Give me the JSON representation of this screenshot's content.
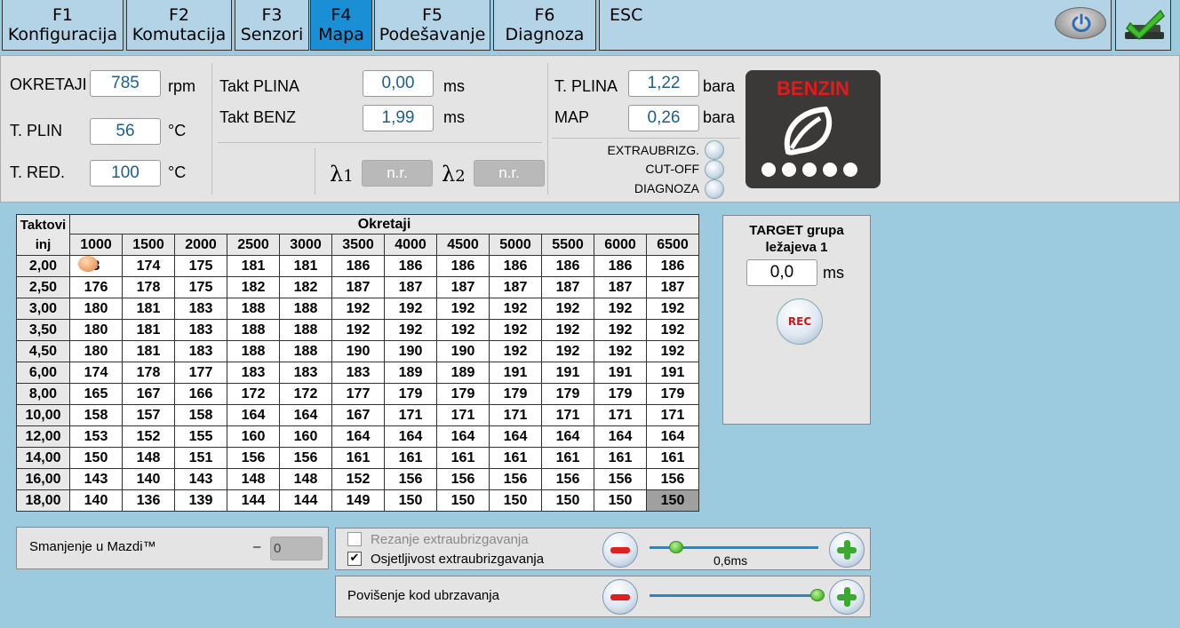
{
  "tabs": [
    {
      "key": "F1",
      "label": "Konfiguracija"
    },
    {
      "key": "F2",
      "label": "Komutacija"
    },
    {
      "key": "F3",
      "label": "Senzori"
    },
    {
      "key": "F4",
      "label": "Mapa"
    },
    {
      "key": "F5",
      "label": "Podešavanje"
    },
    {
      "key": "F6",
      "label": "Diagnoza"
    }
  ],
  "active_tab": "F4",
  "esc_label": "ESC",
  "sensors": {
    "okretaji": {
      "label": "OKRETAJI",
      "value": "785",
      "unit": "rpm"
    },
    "t_plin": {
      "label": "T. PLIN",
      "value": "56",
      "unit": "°C"
    },
    "t_red": {
      "label": "T. RED.",
      "value": "100",
      "unit": "°C"
    },
    "takt_plina": {
      "label": "Takt PLINA",
      "value": "0,00",
      "unit": "ms"
    },
    "takt_benz": {
      "label": "Takt BENZ",
      "value": "1,99",
      "unit": "ms"
    },
    "lambda1": {
      "symbol": "λ",
      "index": "1",
      "value": "n.r."
    },
    "lambda2": {
      "symbol": "λ",
      "index": "2",
      "value": "n.r."
    },
    "t_plina": {
      "label": "T. PLINA",
      "value": "1,22",
      "unit": "bara"
    },
    "map": {
      "label": "MAP",
      "value": "0,26",
      "unit": "bara"
    }
  },
  "indicators": [
    "EXTRAUBRIZG.",
    "CUT-OFF",
    "DIAGNOZA"
  ],
  "fuel_mode": "BENZIN",
  "map_table": {
    "corner_label": "Taktovi inj",
    "col_title": "Okretaji",
    "columns": [
      "1000",
      "1500",
      "2000",
      "2500",
      "3000",
      "3500",
      "4000",
      "4500",
      "5000",
      "5500",
      "6000",
      "6500"
    ],
    "rows": [
      {
        "label": "2,00",
        "values": [
          "3",
          "174",
          "175",
          "181",
          "181",
          "186",
          "186",
          "186",
          "186",
          "186",
          "186",
          "186"
        ]
      },
      {
        "label": "2,50",
        "values": [
          "176",
          "178",
          "175",
          "182",
          "182",
          "187",
          "187",
          "187",
          "187",
          "187",
          "187",
          "187"
        ]
      },
      {
        "label": "3,00",
        "values": [
          "180",
          "181",
          "183",
          "188",
          "188",
          "192",
          "192",
          "192",
          "192",
          "192",
          "192",
          "192"
        ]
      },
      {
        "label": "3,50",
        "values": [
          "180",
          "181",
          "183",
          "188",
          "188",
          "192",
          "192",
          "192",
          "192",
          "192",
          "192",
          "192"
        ]
      },
      {
        "label": "4,50",
        "values": [
          "180",
          "181",
          "183",
          "188",
          "188",
          "190",
          "190",
          "190",
          "192",
          "192",
          "192",
          "192"
        ]
      },
      {
        "label": "6,00",
        "values": [
          "174",
          "178",
          "177",
          "183",
          "183",
          "183",
          "189",
          "189",
          "191",
          "191",
          "191",
          "191"
        ]
      },
      {
        "label": "8,00",
        "values": [
          "165",
          "167",
          "166",
          "172",
          "172",
          "177",
          "179",
          "179",
          "179",
          "179",
          "179",
          "179"
        ]
      },
      {
        "label": "10,00",
        "values": [
          "158",
          "157",
          "158",
          "164",
          "164",
          "167",
          "171",
          "171",
          "171",
          "171",
          "171",
          "171"
        ]
      },
      {
        "label": "12,00",
        "values": [
          "153",
          "152",
          "155",
          "160",
          "160",
          "164",
          "164",
          "164",
          "164",
          "164",
          "164",
          "164"
        ]
      },
      {
        "label": "14,00",
        "values": [
          "150",
          "148",
          "151",
          "156",
          "156",
          "161",
          "161",
          "161",
          "161",
          "161",
          "161",
          "161"
        ]
      },
      {
        "label": "16,00",
        "values": [
          "143",
          "140",
          "143",
          "148",
          "148",
          "152",
          "156",
          "156",
          "156",
          "156",
          "156",
          "156"
        ]
      },
      {
        "label": "18,00",
        "values": [
          "140",
          "136",
          "139",
          "144",
          "144",
          "149",
          "150",
          "150",
          "150",
          "150",
          "150",
          "150"
        ]
      }
    ]
  },
  "target": {
    "title_line1": "TARGET grupa",
    "title_line2": "ležajeva 1",
    "value": "0,0",
    "unit": "ms",
    "rec_label": "REC"
  },
  "smanjenje": {
    "label": "Smanjenje u Mazdi™",
    "sign": "–",
    "value": "0"
  },
  "extra": {
    "rezanje_label": "Rezanje extraubrizgavanja",
    "rezanje_checked": false,
    "osjetljivost_label": "Osjetljivost extraubrizgavanja",
    "osjetljivost_checked": true,
    "check_mark": "✔",
    "slider_value_label": "0,6ms"
  },
  "povisenje": {
    "label": "Povišenje kod ubrzavanja"
  },
  "colors": {
    "background": "#9ccbe0",
    "active_tab": "#1a8fd6",
    "value_text": "#1e5f8e",
    "benzin_red": "#e21a1a"
  }
}
